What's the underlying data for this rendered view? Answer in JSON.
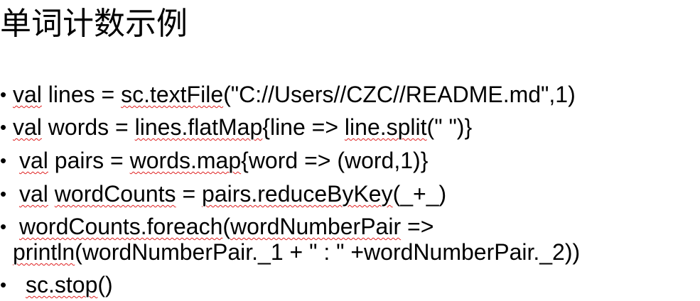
{
  "title": "单词计数示例",
  "bullet_glyph": "•",
  "lines": [
    {
      "segments": [
        {
          "text": "val",
          "squiggle": true
        },
        {
          "text": " lines = ",
          "squiggle": false
        },
        {
          "text": "sc.textFile",
          "squiggle": true
        },
        {
          "text": "(\"C://Users//CZC//README.md\",1)",
          "squiggle": false
        }
      ]
    },
    {
      "segments": [
        {
          "text": "val",
          "squiggle": true
        },
        {
          "text": " words = ",
          "squiggle": false
        },
        {
          "text": "lines.flatMap",
          "squiggle": true
        },
        {
          "text": "{line => ",
          "squiggle": false
        },
        {
          "text": "line.split",
          "squiggle": true
        },
        {
          "text": "(\" \")}",
          "squiggle": false
        }
      ]
    },
    {
      "segments": [
        {
          "text": "val",
          "squiggle": true
        },
        {
          "text": " pairs = ",
          "squiggle": false
        },
        {
          "text": "words.map",
          "squiggle": true
        },
        {
          "text": "{word => (word,1)}",
          "squiggle": false
        }
      ]
    },
    {
      "segments": [
        {
          "text": "val",
          "squiggle": true
        },
        {
          "text": " ",
          "squiggle": false
        },
        {
          "text": "wordCounts",
          "squiggle": true
        },
        {
          "text": " = ",
          "squiggle": false
        },
        {
          "text": "pairs.reduceByKey",
          "squiggle": true
        },
        {
          "text": "(_+_)",
          "squiggle": false
        }
      ]
    },
    {
      "segments": [
        {
          "text": "wordCounts.foreach",
          "squiggle": true
        },
        {
          "text": "(",
          "squiggle": false
        },
        {
          "text": "wordNumberPair",
          "squiggle": true
        },
        {
          "text": " =>",
          "squiggle": false
        }
      ],
      "continuation": [
        {
          "text": "println",
          "squiggle": true
        },
        {
          "text": "(wordNumberPair._1 + \" : \" +wordNumberPair._2))",
          "squiggle": false
        }
      ]
    },
    {
      "segments": [
        {
          "text": "sc.stop",
          "squiggle": true
        },
        {
          "text": "()",
          "squiggle": false
        }
      ]
    }
  ]
}
